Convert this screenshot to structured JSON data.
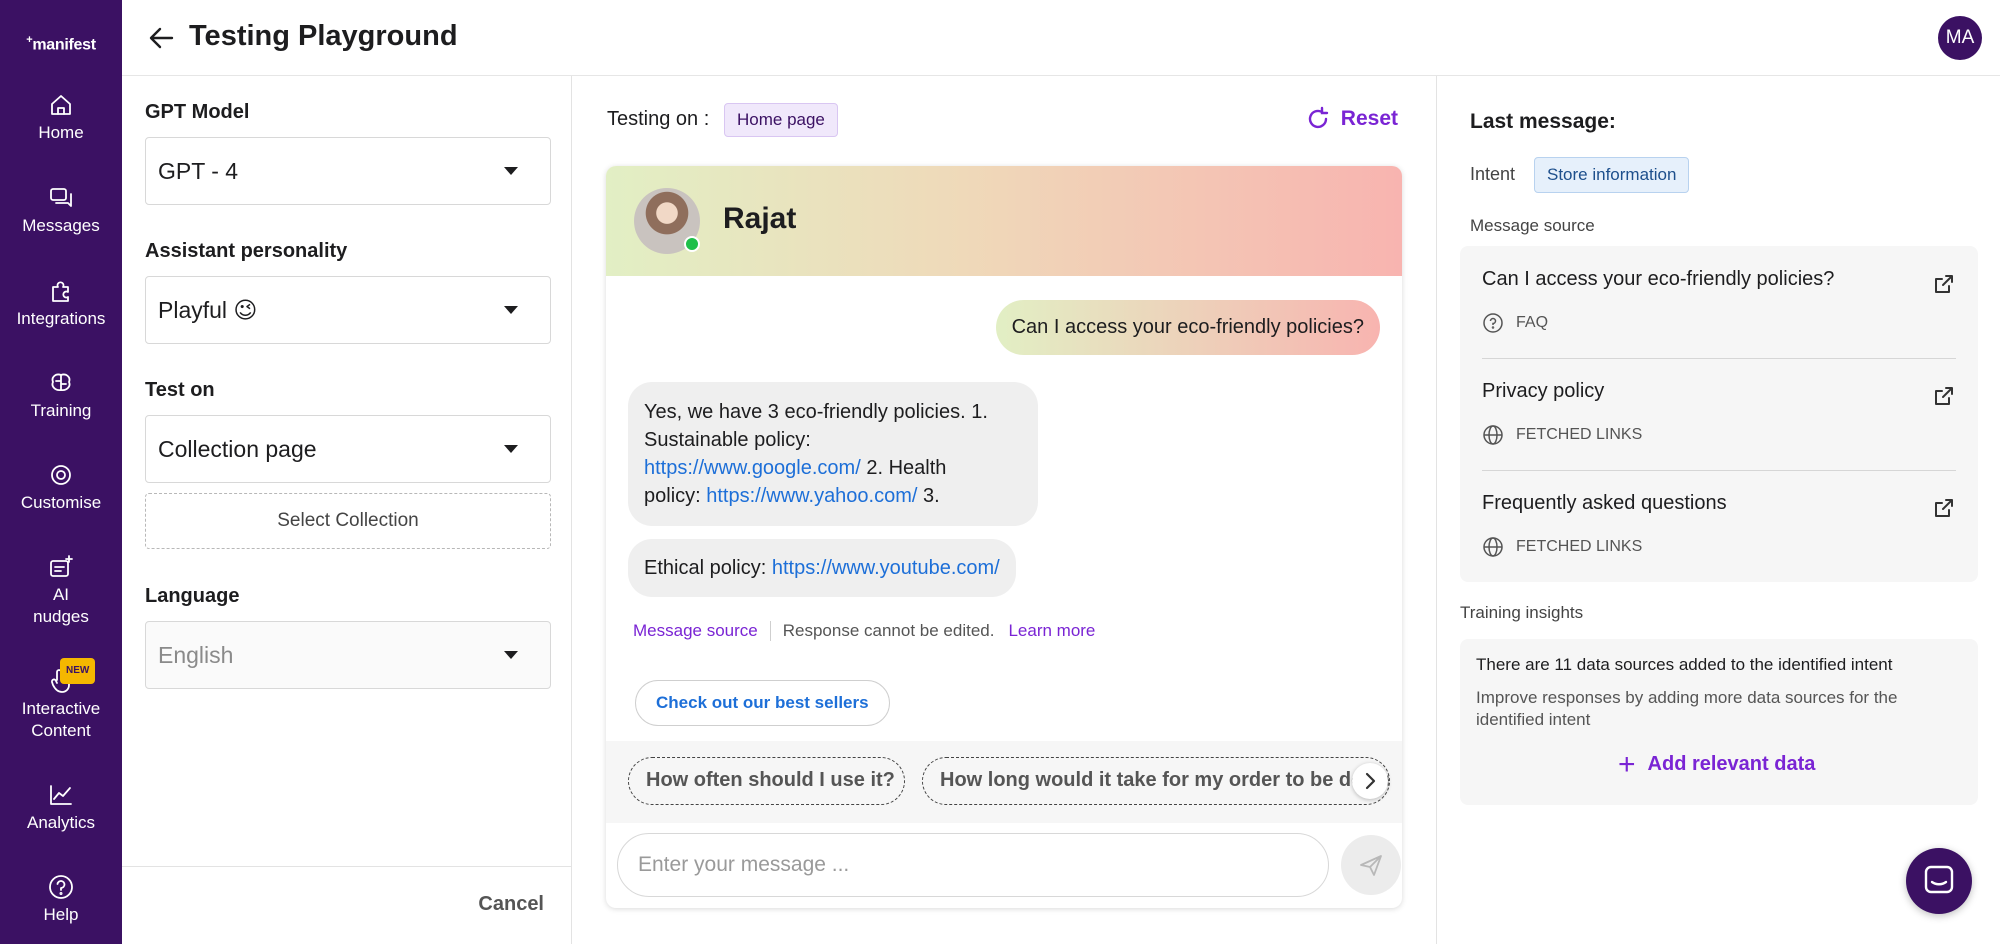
{
  "app": {
    "logo_text": "manifest",
    "logo_mark": "+"
  },
  "sidebar": {
    "items": [
      {
        "label": "Home",
        "icon": "home-icon"
      },
      {
        "label": "Messages",
        "icon": "messages-icon"
      },
      {
        "label": "Integrations",
        "icon": "puzzle-icon"
      },
      {
        "label": "Training",
        "icon": "brain-icon"
      },
      {
        "label": "Customise",
        "icon": "gear-icon"
      },
      {
        "label": "AI",
        "label2": "nudges",
        "icon": "nudge-icon"
      },
      {
        "label": "Interactive",
        "label2": "Content",
        "icon": "pointer-hand-icon",
        "badge": "NEW"
      },
      {
        "label": "Analytics",
        "icon": "chart-icon"
      },
      {
        "label": "Help",
        "icon": "help-icon"
      }
    ]
  },
  "header": {
    "title": "Testing Playground",
    "avatar_initials": "MA"
  },
  "config": {
    "gpt_model_label": "GPT Model",
    "gpt_model_value": "GPT - 4",
    "personality_label": "Assistant personality",
    "personality_value": "Playful 😉",
    "test_on_label": "Test on",
    "test_on_value": "Collection page",
    "select_collection": "Select Collection",
    "language_label": "Language",
    "language_value": "English",
    "cancel": "Cancel"
  },
  "chat": {
    "testing_on_label": "Testing on :",
    "testing_on_value": "Home page",
    "reset": "Reset",
    "agent_name": "Rajat",
    "user_message": "Can I access your eco-friendly policies?",
    "bot_message_1": {
      "text_a": "Yes, we have 3 eco-friendly policies. 1.",
      "text_b": "Sustainable policy:",
      "link_1": "https://www.google.com/",
      "text_c": " 2. Health",
      "text_d": "policy: ",
      "link_2": "https://www.yahoo.com/",
      "text_e": " 3."
    },
    "bot_message_2": {
      "text": "Ethical policy: ",
      "link": "https://www.youtube.com/"
    },
    "meta": {
      "message_source": "Message source",
      "note": "Response cannot be edited.",
      "learn_more": "Learn more"
    },
    "cta": "Check out our best sellers",
    "suggestions": [
      "How often should I use it?",
      "How long would it take for my order to be delivered?"
    ],
    "input_placeholder": "Enter your message ..."
  },
  "right_panel": {
    "title": "Last message:",
    "intent_label": "Intent",
    "intent_value": "Store information",
    "message_source_label": "Message source",
    "sources": [
      {
        "title": "Can I access your eco-friendly policies?",
        "type": "FAQ",
        "icon": "question-circle-icon"
      },
      {
        "title": "Privacy policy",
        "type": "FETCHED LINKS",
        "icon": "globe-icon"
      },
      {
        "title": "Frequently asked questions",
        "type": "FETCHED LINKS",
        "icon": "globe-icon"
      }
    ],
    "training_insights_label": "Training insights",
    "insight_main": "There are 11 data sources added to the identified intent",
    "insight_sub": "Improve responses by adding more data sources for the identified intent",
    "add_data": "Add relevant data"
  },
  "colors": {
    "sidebar_bg": "#3b1163",
    "accent": "#7a24d4",
    "link": "#1d6fd8",
    "online": "#1fbf4a"
  }
}
